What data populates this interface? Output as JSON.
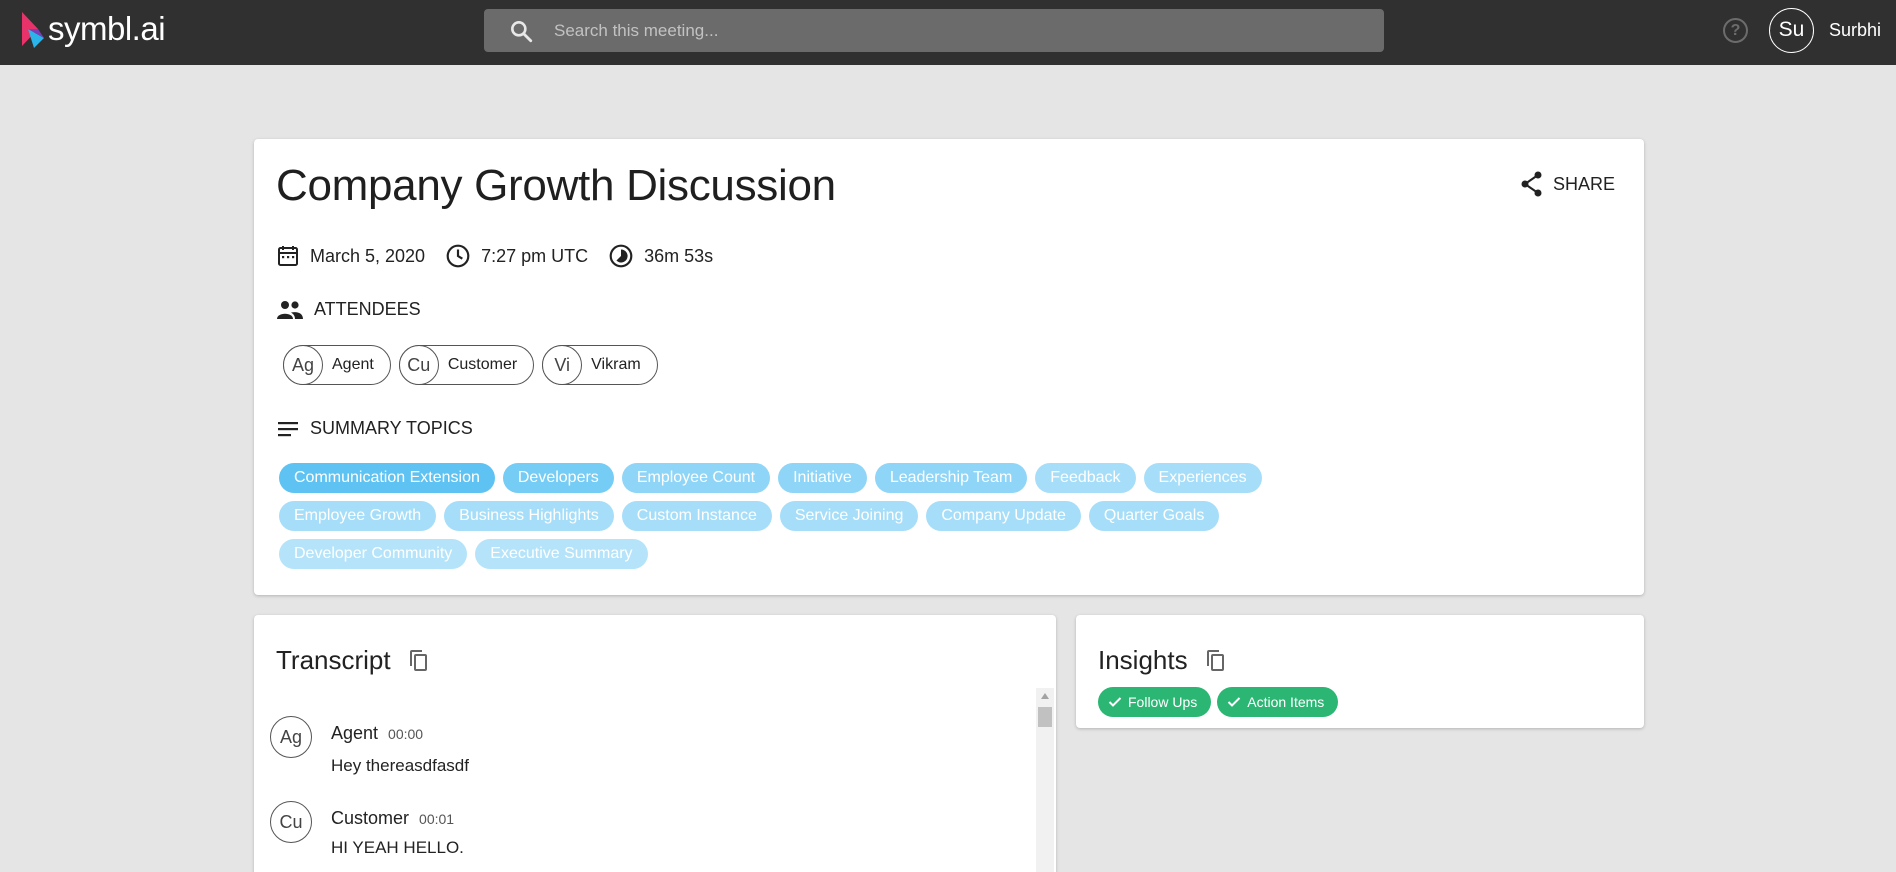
{
  "header": {
    "logo_text": "symbl.ai",
    "search_placeholder": "Search this meeting...",
    "help_icon": "?",
    "user_initials": "Su",
    "user_name": "Surbhi"
  },
  "meeting": {
    "title": "Company Growth Discussion",
    "share_label": "SHARE",
    "date": "March 5, 2020",
    "time": "7:27 pm UTC",
    "duration": "36m 53s"
  },
  "attendees": {
    "heading": "ATTENDEES",
    "list": [
      {
        "initials": "Ag",
        "name": "Agent"
      },
      {
        "initials": "Cu",
        "name": "Customer"
      },
      {
        "initials": "Vi",
        "name": "Vikram"
      }
    ]
  },
  "summary_topics": {
    "heading": "SUMMARY TOPICS",
    "topics": [
      {
        "label": "Communication Extension",
        "color": "#5ec3f2"
      },
      {
        "label": "Developers",
        "color": "#75ccf5"
      },
      {
        "label": "Employee Count",
        "color": "#8ed5f7"
      },
      {
        "label": "Initiative",
        "color": "#8ed5f7"
      },
      {
        "label": "Leadership Team",
        "color": "#8ed5f7"
      },
      {
        "label": "Feedback",
        "color": "#a6def9"
      },
      {
        "label": "Experiences",
        "color": "#a6def9"
      },
      {
        "label": "Employee Growth",
        "color": "#a6def9"
      },
      {
        "label": "Business Highlights",
        "color": "#a6def9"
      },
      {
        "label": "Custom Instance",
        "color": "#a6def9"
      },
      {
        "label": "Service Joining",
        "color": "#a6def9"
      },
      {
        "label": "Company Update",
        "color": "#a6def9"
      },
      {
        "label": "Quarter Goals",
        "color": "#a6def9"
      },
      {
        "label": "Developer Community",
        "color": "#b5e4fa"
      },
      {
        "label": "Executive Summary",
        "color": "#b5e4fa"
      }
    ]
  },
  "transcript": {
    "heading": "Transcript",
    "messages": [
      {
        "initials": "Ag",
        "speaker": "Agent",
        "time": "00:00",
        "text": "Hey thereasdfasdf"
      },
      {
        "initials": "Cu",
        "speaker": "Customer",
        "time": "00:01",
        "text": "HI YEAH HELLO."
      }
    ]
  },
  "insights": {
    "heading": "Insights",
    "chips": [
      {
        "label": "Follow Ups"
      },
      {
        "label": "Action Items"
      }
    ],
    "chip_color": "#2bb673"
  }
}
